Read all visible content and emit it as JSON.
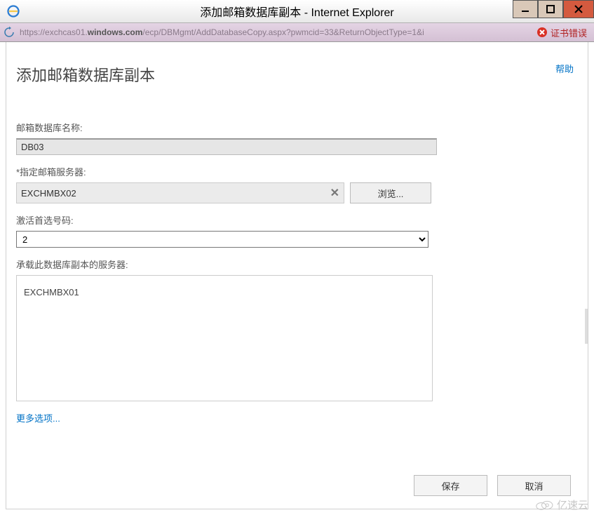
{
  "window": {
    "title_prefix": "添加邮箱数据库副本 - ",
    "title_app": "Internet Explorer"
  },
  "addressbar": {
    "url_pre": "https://exchcas01.",
    "url_bold": "windows.com",
    "url_post": "/ecp/DBMgmt/AddDatabaseCopy.aspx?pwmcid=33&ReturnObjectType=1&i",
    "cert_error": "证书错误"
  },
  "page": {
    "help": "帮助",
    "title": "添加邮箱数据库副本",
    "db_name_label": "邮箱数据库名称:",
    "db_name_value": "DB03",
    "server_label": "*指定邮箱服务器:",
    "server_value": "EXCHMBX02",
    "browse_btn": "浏览...",
    "activation_label": "激活首选号码:",
    "activation_value": "2",
    "hosting_label": "承载此数据库副本的服务器:",
    "hosting_server": "EXCHMBX01",
    "more_options": "更多选项...",
    "save_btn": "保存",
    "cancel_btn": "取消"
  },
  "watermark": "亿速云"
}
